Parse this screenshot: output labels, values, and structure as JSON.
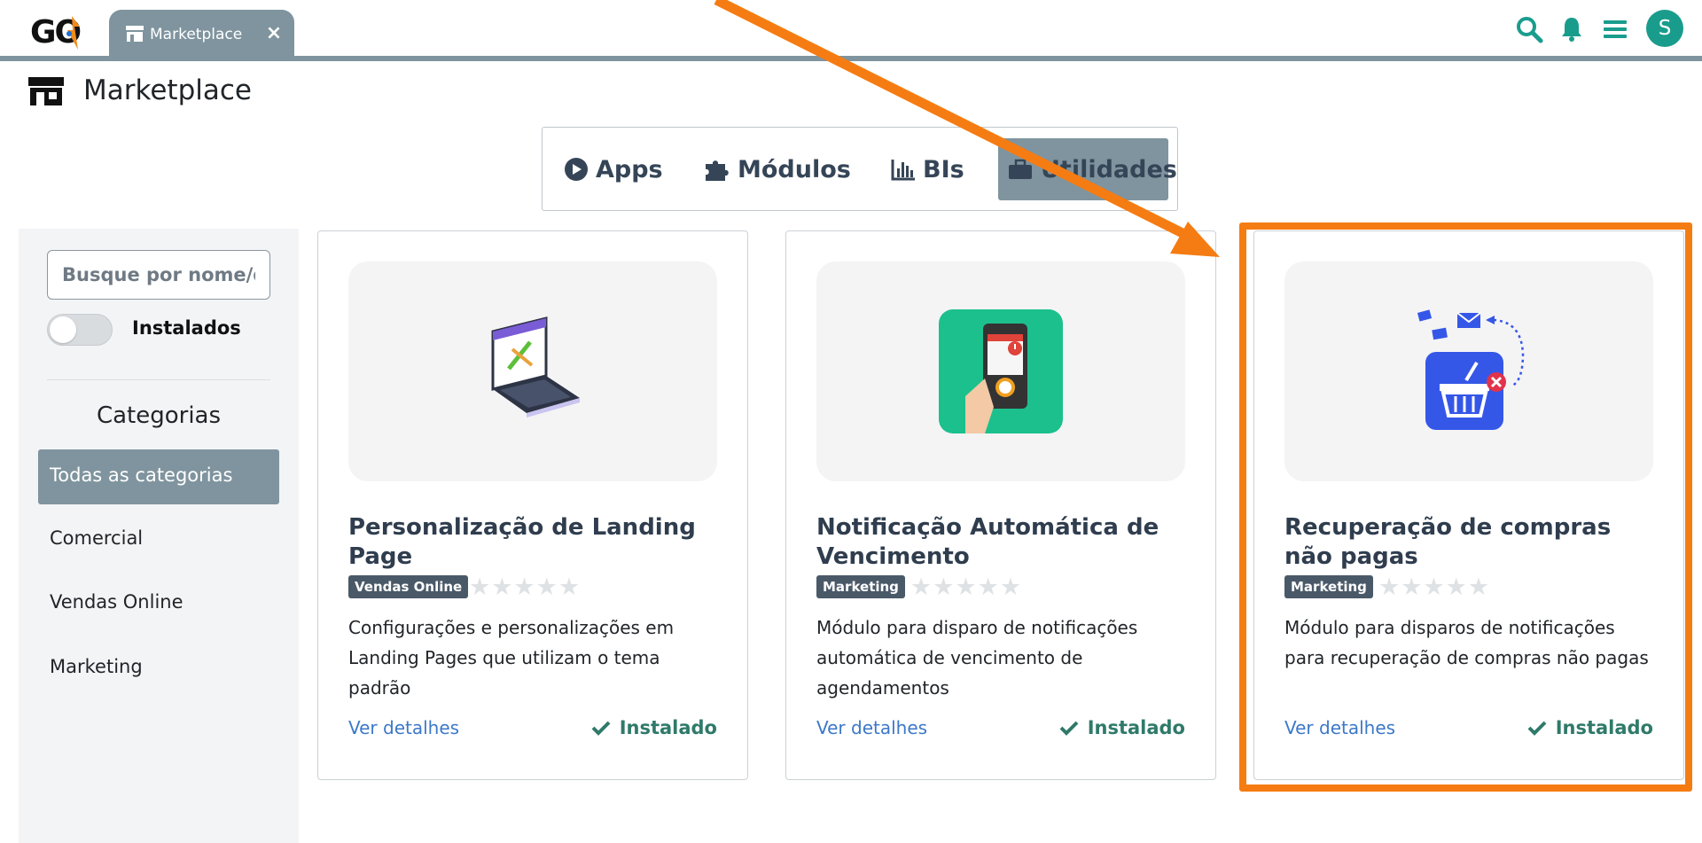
{
  "app": {
    "logo_text": "GO"
  },
  "tab": {
    "label": "Marketplace",
    "close_symbol": "×"
  },
  "user": {
    "initial": "S"
  },
  "page": {
    "title": "Marketplace"
  },
  "segments": [
    {
      "label": "Apps",
      "icon": "play-circle-icon",
      "active": false
    },
    {
      "label": "Módulos",
      "icon": "puzzle-icon",
      "active": false
    },
    {
      "label": "BIs",
      "icon": "bar-chart-icon",
      "active": false
    },
    {
      "label": "Utilidades",
      "icon": "toolbox-icon",
      "active": true
    }
  ],
  "sidebar": {
    "search_placeholder": "Busque por nome/descrição",
    "toggle_label": "Instalados",
    "categories_title": "Categorias",
    "categories": [
      "Todas as categorias",
      "Comercial",
      "Vendas Online",
      "Marketing"
    ],
    "active_category": "Todas as categorias"
  },
  "cards": [
    {
      "title": "Personalização de Landing Page",
      "badge": "Vendas Online",
      "rating": "★★★★★",
      "description": "Configurações e personalizações em Landing Pages que utilizam o tema padrão",
      "link": "Ver detalhes",
      "status": "Instalado"
    },
    {
      "title": "Notificação Automática de Vencimento",
      "badge": "Marketing",
      "rating": "★★★★★",
      "description": "Módulo para disparo de notificações automática de vencimento de agendamentos",
      "link": "Ver detalhes",
      "status": "Instalado"
    },
    {
      "title": "Recuperação de compras não pagas",
      "badge": "Marketing",
      "rating": "★★★★★",
      "description": "Módulo para disparos de notificações para recuperação de compras não pagas",
      "link": "Ver detalhes",
      "status": "Instalado"
    }
  ],
  "colors": {
    "accent_teal": "#1a9c8d",
    "tab_gray": "#7f949e",
    "annotation_orange": "#f57c12",
    "link_blue": "#3d78c9",
    "installed_green": "#2f7a6a"
  }
}
